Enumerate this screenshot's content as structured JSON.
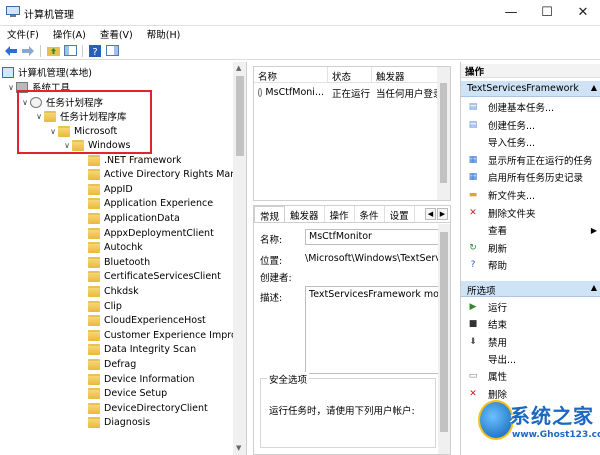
{
  "window": {
    "title": "计算机管理"
  },
  "menu": [
    "文件(F)",
    "操作(A)",
    "查看(V)",
    "帮助(H)"
  ],
  "tree": {
    "root": "计算机管理(本地)",
    "system_tools": "系统工具",
    "task_scheduler": "任务计划程序",
    "task_library": "任务计划程序库",
    "microsoft": "Microsoft",
    "windows": "Windows",
    "folders": [
      ".NET Framework",
      "Active Directory Rights Manag",
      "AppID",
      "Application Experience",
      "ApplicationData",
      "AppxDeploymentClient",
      "Autochk",
      "Bluetooth",
      "CertificateServicesClient",
      "Chkdsk",
      "Clip",
      "CloudExperienceHost",
      "Customer Experience Improve",
      "Data Integrity Scan",
      "Defrag",
      "Device Information",
      "Device Setup",
      "DeviceDirectoryClient",
      "Diagnosis"
    ]
  },
  "list": {
    "columns": [
      "名称",
      "状态",
      "触发器"
    ],
    "rows": [
      {
        "name": "MsCtfMoni...",
        "status": "正在运行",
        "trigger": "当任何用户登录时"
      }
    ]
  },
  "detail": {
    "tabs": [
      "常规",
      "触发器",
      "操作",
      "条件",
      "设置"
    ],
    "name_label": "名称:",
    "name_value": "MsCtfMonitor",
    "location_label": "位置:",
    "location_value": "\\Microsoft\\Windows\\TextServic",
    "author_label": "创建者:",
    "desc_label": "描述:",
    "desc_value": "TextServicesFramework monito",
    "security_legend": "安全选项",
    "security_text": "运行任务时，请使用下列用户帐户:"
  },
  "actions": {
    "header": "操作",
    "section1": "TextServicesFramework",
    "section1_items": [
      "创建基本任务...",
      "创建任务...",
      "导入任务...",
      "显示所有正在运行的任务",
      "启用所有任务历史记录",
      "新文件夹...",
      "删除文件夹",
      "查看",
      "刷新",
      "帮助"
    ],
    "section2": "所选项",
    "section2_items": [
      "运行",
      "结束",
      "禁用",
      "导出...",
      "属性",
      "删除"
    ]
  },
  "watermark": {
    "text": "系统之家",
    "url": "www.Ghost123.com"
  }
}
